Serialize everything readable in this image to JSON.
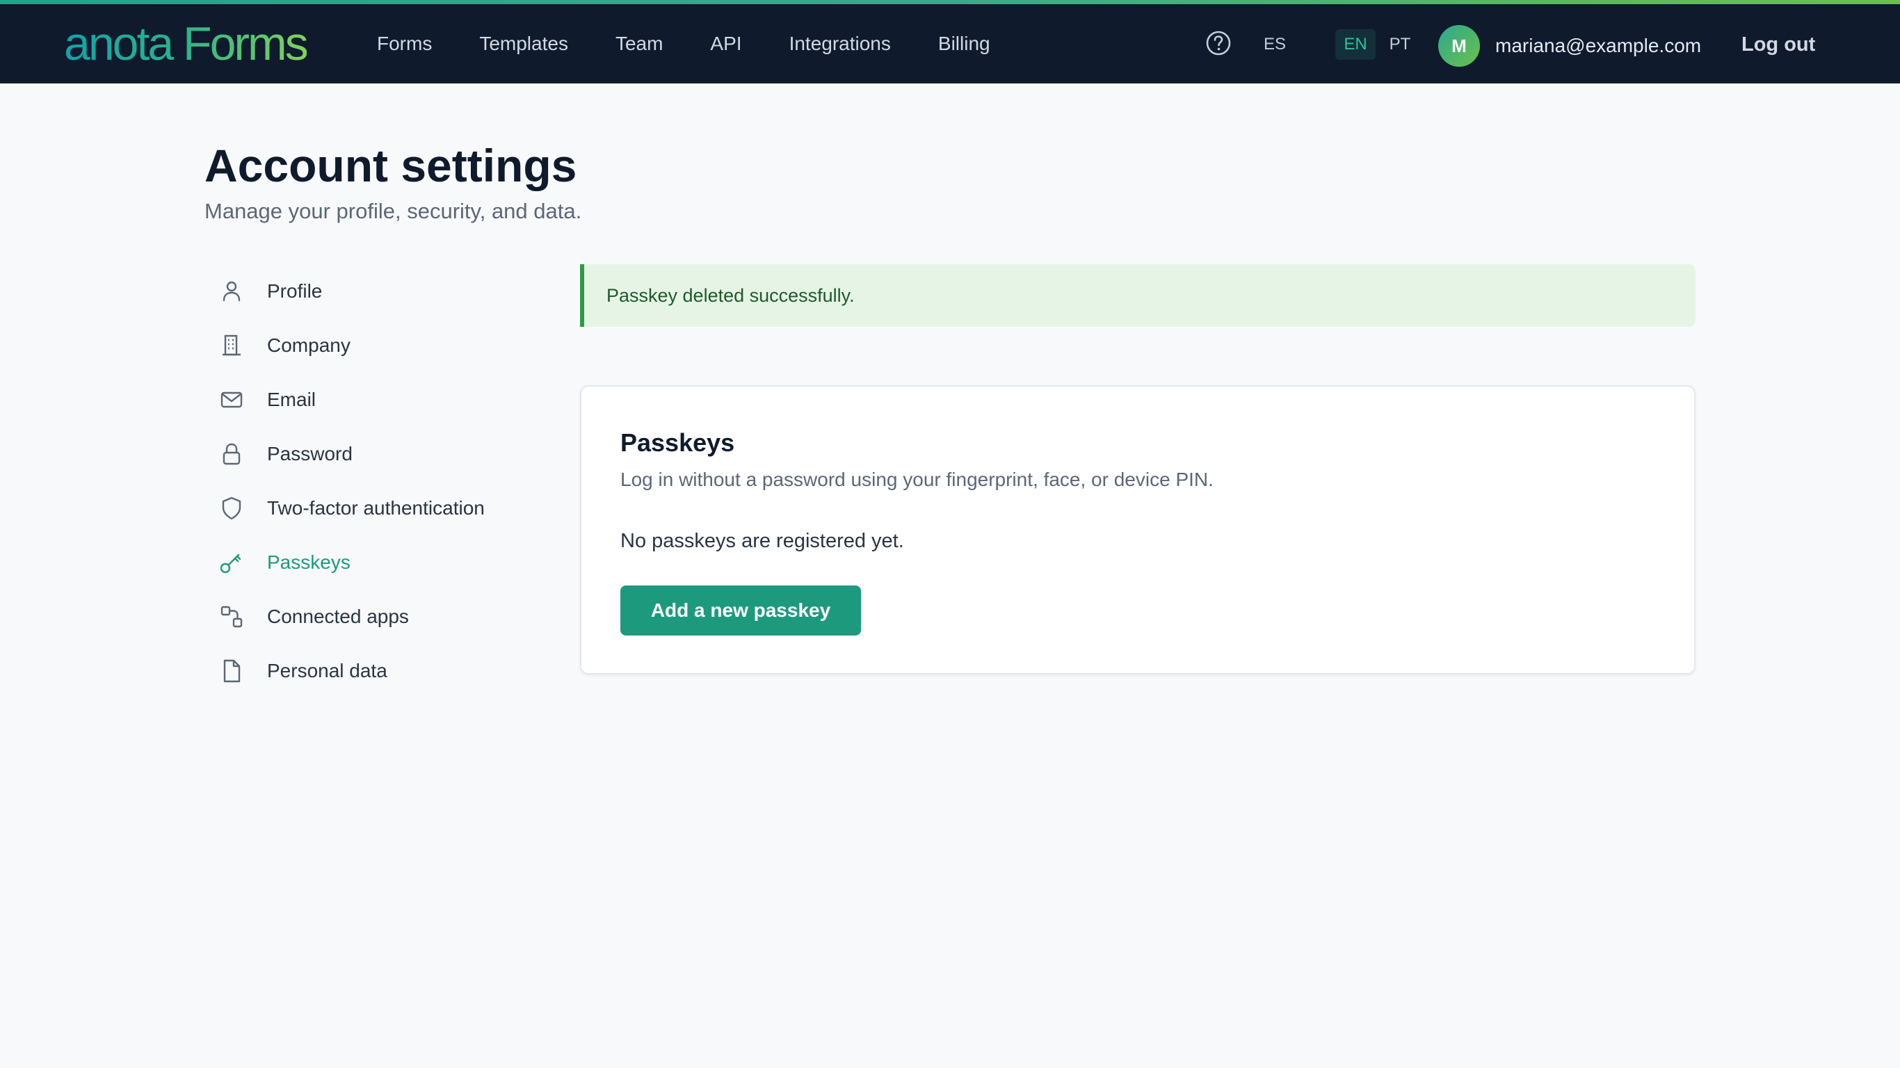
{
  "brand": {
    "name": "anota Forms"
  },
  "nav": {
    "items": [
      "Forms",
      "Templates",
      "Team",
      "API",
      "Integrations",
      "Billing"
    ]
  },
  "header": {
    "help_icon": "question-circle-icon",
    "languages": [
      "ES",
      "EN",
      "PT"
    ],
    "active_language": "EN",
    "avatar_initial": "M",
    "user_email": "mariana@example.com",
    "logout_label": "Log out"
  },
  "page": {
    "title": "Account settings",
    "subtitle": "Manage your profile, security, and data."
  },
  "sidebar": {
    "items": [
      {
        "label": "Profile",
        "icon": "user-icon"
      },
      {
        "label": "Company",
        "icon": "building-icon"
      },
      {
        "label": "Email",
        "icon": "mail-icon"
      },
      {
        "label": "Password",
        "icon": "lock-icon"
      },
      {
        "label": "Two-factor authentication",
        "icon": "shield-icon"
      },
      {
        "label": "Passkeys",
        "icon": "key-icon",
        "active": true
      },
      {
        "label": "Connected apps",
        "icon": "connected-apps-icon"
      },
      {
        "label": "Personal data",
        "icon": "document-icon"
      }
    ]
  },
  "alert": {
    "message": "Passkey deleted successfully."
  },
  "passkeys": {
    "title": "Passkeys",
    "description": "Log in without a password using your fingerprint, face, or device PIN.",
    "empty_message": "No passkeys are registered yet.",
    "add_button_label": "Add a new passkey"
  },
  "colors": {
    "accent": "#1d9a7e",
    "topbar": "#0f1b2d",
    "success_bg": "#e6f4e6",
    "success_border": "#2f9a47"
  }
}
